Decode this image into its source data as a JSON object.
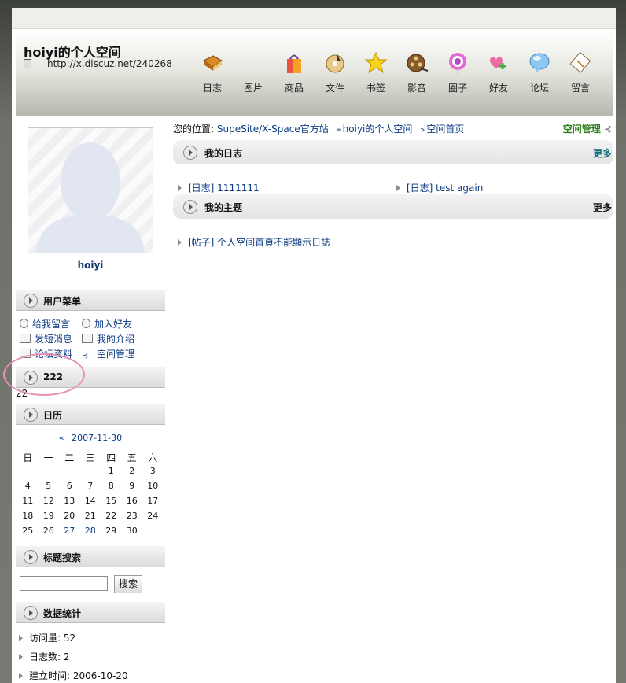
{
  "header": {
    "title": "hoiyi的个人空间",
    "url": "http://x.discuz.net/240268"
  },
  "nav": [
    {
      "label": "日志",
      "icon": "book-icon"
    },
    {
      "label": "图片",
      "icon": "picture-icon"
    },
    {
      "label": "商品",
      "icon": "shopping-bag-icon"
    },
    {
      "label": "文件",
      "icon": "file-disc-icon"
    },
    {
      "label": "书签",
      "icon": "star-icon"
    },
    {
      "label": "影音",
      "icon": "film-reel-icon"
    },
    {
      "label": "圈子",
      "icon": "swirl-candy-icon"
    },
    {
      "label": "好友",
      "icon": "hearts-icon"
    },
    {
      "label": "论坛",
      "icon": "speech-bubble-icon"
    },
    {
      "label": "留言",
      "icon": "note-icon"
    }
  ],
  "sidebar": {
    "username": "hoiyi",
    "user_menu_title": "用户菜单",
    "user_menu": [
      {
        "label": "给我留言",
        "icon": "comment-icon"
      },
      {
        "label": "加入好友",
        "icon": "add-friend-icon"
      },
      {
        "label": "发短消息",
        "icon": "mail-icon"
      },
      {
        "label": "我的介绍",
        "icon": "card-icon"
      },
      {
        "label": "论坛资料",
        "icon": "profile-icon"
      },
      {
        "label": "空间管理",
        "icon": "manage-icon"
      }
    ],
    "custom_title": "222",
    "custom_content": "22",
    "calendar_title": "日历",
    "calendar_prev": "«",
    "calendar_month": "2007-11-30",
    "calendar_weekdays": [
      "日",
      "一",
      "二",
      "三",
      "四",
      "五",
      "六"
    ],
    "calendar_rows": [
      [
        "",
        "",
        "",
        "",
        "1",
        "2",
        "3"
      ],
      [
        "4",
        "5",
        "6",
        "7",
        "8",
        "9",
        "10"
      ],
      [
        "11",
        "12",
        "13",
        "14",
        "15",
        "16",
        "17"
      ],
      [
        "18",
        "19",
        "20",
        "21",
        "22",
        "23",
        "24"
      ],
      [
        "25",
        "26",
        "27",
        "28",
        "29",
        "30",
        ""
      ]
    ],
    "calendar_links": [
      "27",
      "28"
    ],
    "search_title": "标题搜索",
    "search_value": "",
    "search_button": "搜索",
    "stats_title": "数据统计",
    "stats": [
      "访问量: 52",
      "日志数: 2",
      "建立时间: 2006-10-20"
    ]
  },
  "breadcrumb": {
    "prefix": "您的位置:",
    "items": [
      "SupeSite/X-Space官方站",
      "hoiyi的个人空间",
      "空间首页"
    ],
    "sep": "»"
  },
  "space_admin": "空间管理",
  "blog_section": {
    "title": "我的日志",
    "more": "更多",
    "entries": [
      "[日志] 1111111",
      "[日志] test again"
    ]
  },
  "topic_section": {
    "title": "我的主题",
    "more": "更多",
    "entries": [
      "[帖子] 个人空间首頁不能顯示日誌"
    ]
  },
  "colors": {
    "link": "#0a3a83",
    "admin_green": "#2d7d1c",
    "annotation_circle": "#e693b3"
  }
}
